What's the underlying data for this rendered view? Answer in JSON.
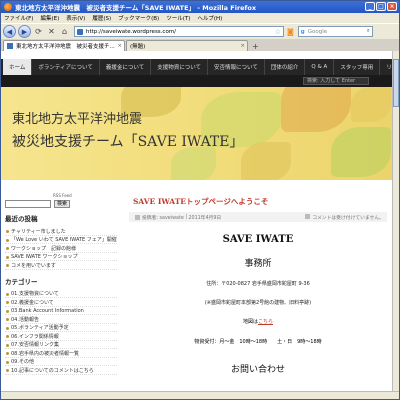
{
  "window": {
    "title": "東北地方太平洋沖地震　被災者支援チーム「SAVE IWATE」 - Mozilla Firefox",
    "min": "_",
    "max": "□",
    "close": "×"
  },
  "menu": [
    "ファイル(F)",
    "編集(E)",
    "表示(V)",
    "履歴(S)",
    "ブックマーク(B)",
    "ツール(T)",
    "ヘルプ(H)"
  ],
  "nav": {
    "url": "http://saveiwate.wordpress.com/",
    "search_placeholder": "Google"
  },
  "tabs": [
    {
      "label": "東北地方太平洋沖地震　被災者支援チ..."
    },
    {
      "label": "(無題)"
    }
  ],
  "site": {
    "nav_items": [
      "ホーム",
      "ボランティアについて",
      "義援金について",
      "支援物資について",
      "安否情報について",
      "団体の紹介",
      "Q & A",
      "スタッフ専用",
      "リンク"
    ],
    "search_placeholder": "検索: 入力して Enter",
    "banner_line1": "東北地方太平洋沖地震",
    "banner_line2": "被災地支援チーム「SAVE IWATE」"
  },
  "sidebar": {
    "rss": "RSS Feed",
    "search_button": "検索",
    "recent_heading": "最近の投稿",
    "recent": [
      "チャリティー市しました",
      "「We Love いわて SAVE IWATE フェア」開催",
      "ワークショップ　記録の館様",
      "SAVE IWATE ワークショップ",
      "コメを用いでいます"
    ],
    "category_heading": "カテゴリー",
    "categories": [
      "01.支援物資について",
      "02.義援金について",
      "03.Bank Account Information",
      "04.活動報告",
      "05.ボランティア活動予定",
      "06.インフラ関係情報",
      "07.安否情報リンク集",
      "08.岩手県内の被災者情報一覧",
      "09.その他",
      "10.記事についてのコメントはこちら"
    ]
  },
  "post": {
    "title": "SAVE IWATEトップページへようこそ",
    "meta_author": "投稿者: saveiwate",
    "meta_date": "2011年4月9日",
    "meta_comments": "コメントは受け付けていません。",
    "h1": "SAVE IWATE",
    "h2": "事務所",
    "address": "住所：〒020-0827 岩手県盛岡市鉈屋町 9-36",
    "address_note": "(※盛岡市鉈屋町本部第2号館の建物、旧料亭跡)",
    "map_prefix": "地図は",
    "map_link": "こちら",
    "hours": "物資受付：月～金　10時～18時　　土・日　9時～18時",
    "contact": "お問い合わせ"
  }
}
